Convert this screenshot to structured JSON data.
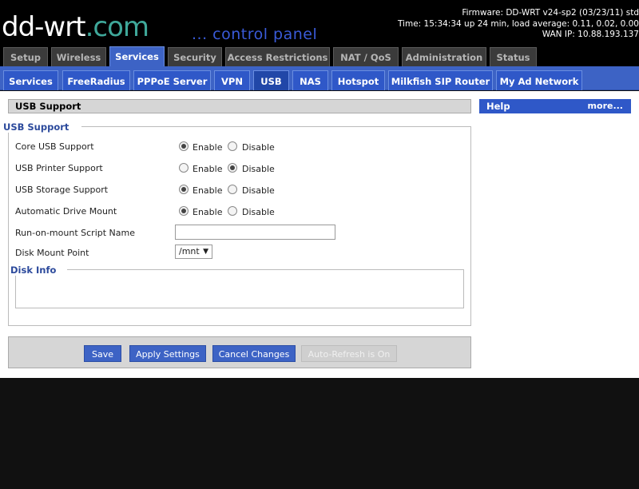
{
  "header": {
    "logo_main": "dd-wrt",
    "logo_suffix": ".com",
    "control_panel": "... control panel",
    "firmware": "Firmware: DD-WRT v24-sp2 (03/23/11) std",
    "time": "Time: 15:34:34 up 24 min, load average: 0.11, 0.02, 0.00",
    "wan_ip": "WAN IP: 10.88.193.137"
  },
  "main_tabs": [
    "Setup",
    "Wireless",
    "Services",
    "Security",
    "Access Restrictions",
    "NAT / QoS",
    "Administration",
    "Status"
  ],
  "sub_tabs": [
    "Services",
    "FreeRadius",
    "PPPoE Server",
    "VPN",
    "USB",
    "NAS",
    "Hotspot",
    "Milkfish SIP Router",
    "My Ad Network"
  ],
  "section": {
    "title": "USB Support",
    "legend": "USB Support",
    "rows": [
      {
        "label": "Core USB Support",
        "enable": "Enable",
        "disable": "Disable",
        "selected": "enable"
      },
      {
        "label": "USB Printer Support",
        "enable": "Enable",
        "disable": "Disable",
        "selected": "disable"
      },
      {
        "label": "USB Storage Support",
        "enable": "Enable",
        "disable": "Disable",
        "selected": "enable"
      },
      {
        "label": "Automatic Drive Mount",
        "enable": "Enable",
        "disable": "Disable",
        "selected": "enable"
      }
    ],
    "script_label": "Run-on-mount Script Name",
    "script_value": "",
    "mount_label": "Disk Mount Point",
    "mount_value": "/mnt",
    "disk_info_legend": "Disk Info"
  },
  "buttons": {
    "save": "Save",
    "apply": "Apply Settings",
    "cancel": "Cancel Changes",
    "refresh": "Auto-Refresh is On"
  },
  "help": {
    "title": "Help",
    "more": "more..."
  },
  "colors": {
    "accent": "#3d63c5",
    "tab_dark": "#3b3b3b",
    "legend": "#2c4a9c"
  }
}
